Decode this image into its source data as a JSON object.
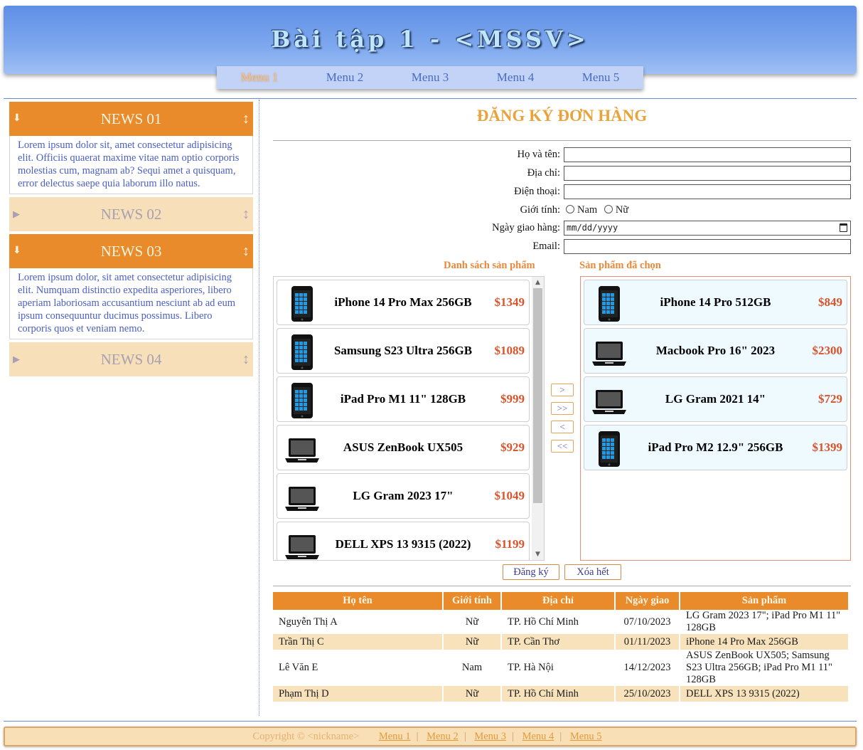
{
  "header": {
    "title": "Bài tập 1 - <MSSV>"
  },
  "menu": [
    "Menu 1",
    "Menu 2",
    "Menu 3",
    "Menu 4",
    "Menu 5"
  ],
  "sidebar": {
    "news": [
      {
        "title": "NEWS 01",
        "expanded": true,
        "body": "Lorem ipsum dolor sit, amet consectetur adipisicing elit. Officiis quaerat maxime vitae nam optio corporis molestias cum, magnam ab? Sequi amet a quisquam, error delectus saepe quia laborum illo natus."
      },
      {
        "title": "NEWS 02",
        "expanded": false
      },
      {
        "title": "NEWS 03",
        "expanded": true,
        "body": "Lorem ipsum dolor, sit amet consectetur adipisicing elit. Numquam distinctio expedita asperiores, libero aperiam laboriosam accusantium nesciunt ab ad eum ipsum consequuntur ducimus possimus. Libero corporis quos et veniam nemo."
      },
      {
        "title": "NEWS 04",
        "expanded": false
      }
    ]
  },
  "form": {
    "title": "ĐĂNG KÝ ĐƠN HÀNG",
    "labels": {
      "name": "Họ và tên:",
      "address": "Địa chỉ:",
      "phone": "Điện thoại:",
      "gender": "Giới tính:",
      "date": "Ngày giao hàng:",
      "email": "Email:"
    },
    "gender_options": [
      "Nam",
      "Nữ"
    ],
    "date_placeholder": "mm/dd/yyyy"
  },
  "products": {
    "available_caption": "Danh sách sản phẩm",
    "selected_caption": "Sản phẩm đã chọn",
    "available": [
      {
        "name": "iPhone 14 Pro Max 256GB",
        "price": "$1349",
        "icon": "phone-icon"
      },
      {
        "name": "Samsung S23 Ultra 256GB",
        "price": "$1089",
        "icon": "phone-icon"
      },
      {
        "name": "iPad Pro M1 11\" 128GB",
        "price": "$999",
        "icon": "phone-icon"
      },
      {
        "name": "ASUS ZenBook UX505",
        "price": "$929",
        "icon": "laptop-icon"
      },
      {
        "name": "LG Gram 2023 17\"",
        "price": "$1049",
        "icon": "laptop-icon"
      },
      {
        "name": "DELL XPS 13 9315 (2022)",
        "price": "$1199",
        "icon": "laptop-icon"
      }
    ],
    "selected": [
      {
        "name": "iPhone 14 Pro 512GB",
        "price": "$849",
        "icon": "phone-icon"
      },
      {
        "name": "Macbook Pro 16\" 2023",
        "price": "$2300",
        "icon": "laptop-icon"
      },
      {
        "name": "LG Gram 2021 14\"",
        "price": "$729",
        "icon": "laptop-icon"
      },
      {
        "name": "iPad Pro M2 12.9\" 256GB",
        "price": "$1399",
        "icon": "phone-icon"
      }
    ],
    "move_buttons": [
      ">",
      ">>",
      "<",
      "<<"
    ]
  },
  "actions": {
    "submit": "Đăng ký",
    "clear": "Xóa hết"
  },
  "orders": {
    "headers": [
      "Họ tên",
      "Giới tính",
      "Địa chỉ",
      "Ngày giao",
      "Sản phẩm"
    ],
    "rows": [
      [
        "Nguyễn Thị A",
        "Nữ",
        "TP. Hồ Chí Minh",
        "07/10/2023",
        "LG Gram 2023 17\"; iPad Pro M1 11\" 128GB"
      ],
      [
        "Trần Thị C",
        "Nữ",
        "TP. Cần Thơ",
        "01/11/2023",
        "iPhone 14 Pro Max 256GB"
      ],
      [
        "Lê Văn E",
        "Nam",
        "TP. Hà Nội",
        "14/12/2023",
        "ASUS ZenBook UX505; Samsung S23 Ultra 256GB; iPad Pro M1 11\" 128GB"
      ],
      [
        "Phạm Thị D",
        "Nữ",
        "TP. Hồ Chí Minh",
        "25/10/2023",
        "DELL XPS 13 9315 (2022)"
      ]
    ]
  },
  "footer": {
    "copyright": "Copyright © <nickname>",
    "links": [
      "Menu 1",
      "Menu 2",
      "Menu 3",
      "Menu 4",
      "Menu 5"
    ]
  },
  "colors": {
    "accent": "#e98b2b",
    "header_blue": "#7ea8ee",
    "price": "#d9542a"
  }
}
